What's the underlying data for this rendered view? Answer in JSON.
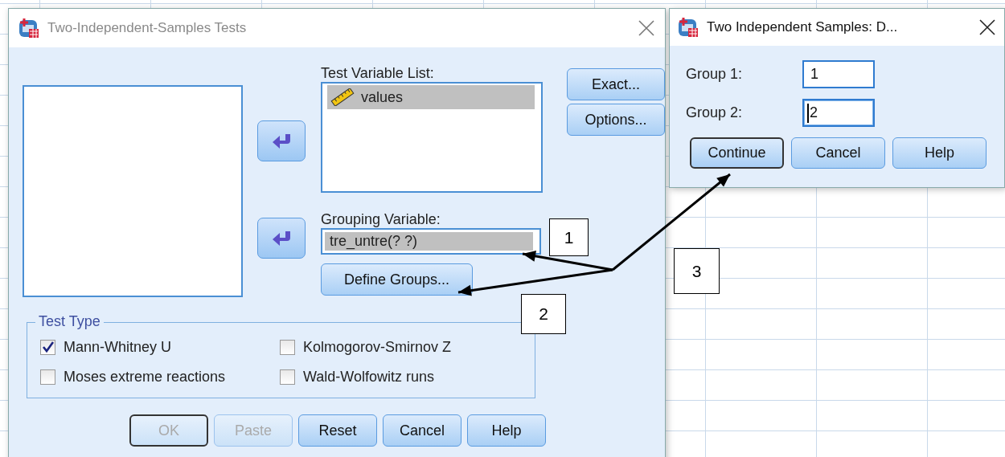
{
  "main_dialog": {
    "title": "Two-Independent-Samples Tests",
    "active": false,
    "test_variable_list": {
      "label": "Test Variable List:",
      "items": [
        {
          "name": "values",
          "selected": true
        }
      ]
    },
    "grouping_variable": {
      "label": "Grouping Variable:",
      "value": "tre_untre(? ?)",
      "selected": true
    },
    "define_groups_button": "Define Groups...",
    "side_buttons": [
      "Exact...",
      "Options..."
    ],
    "test_type": {
      "title": "Test Type",
      "options": [
        {
          "label": "Mann-Whitney U",
          "checked": true
        },
        {
          "label": "Kolmogorov-Smirnov Z",
          "checked": false
        },
        {
          "label": "Moses extreme reactions",
          "checked": false
        },
        {
          "label": "Wald-Wolfowitz runs",
          "checked": false
        }
      ]
    },
    "buttons": [
      {
        "label": "OK",
        "disabled": true,
        "default": true
      },
      {
        "label": "Paste",
        "disabled": true,
        "default": false
      },
      {
        "label": "Reset",
        "disabled": false,
        "default": false
      },
      {
        "label": "Cancel",
        "disabled": false,
        "default": false
      },
      {
        "label": "Help",
        "disabled": false,
        "default": false
      }
    ]
  },
  "define_groups_dialog": {
    "title": "Two Independent Samples: D...",
    "active": true,
    "fields": [
      {
        "label": "Group 1:",
        "value": "1",
        "focused": false
      },
      {
        "label": "Group 2:",
        "value": "2",
        "focused": true
      }
    ],
    "buttons": [
      {
        "label": "Continue",
        "disabled": false,
        "default": true
      },
      {
        "label": "Cancel",
        "disabled": false,
        "default": false
      },
      {
        "label": "Help",
        "disabled": false,
        "default": false
      }
    ]
  },
  "annotations": [
    {
      "label": "1"
    },
    {
      "label": "2"
    },
    {
      "label": "3"
    }
  ]
}
